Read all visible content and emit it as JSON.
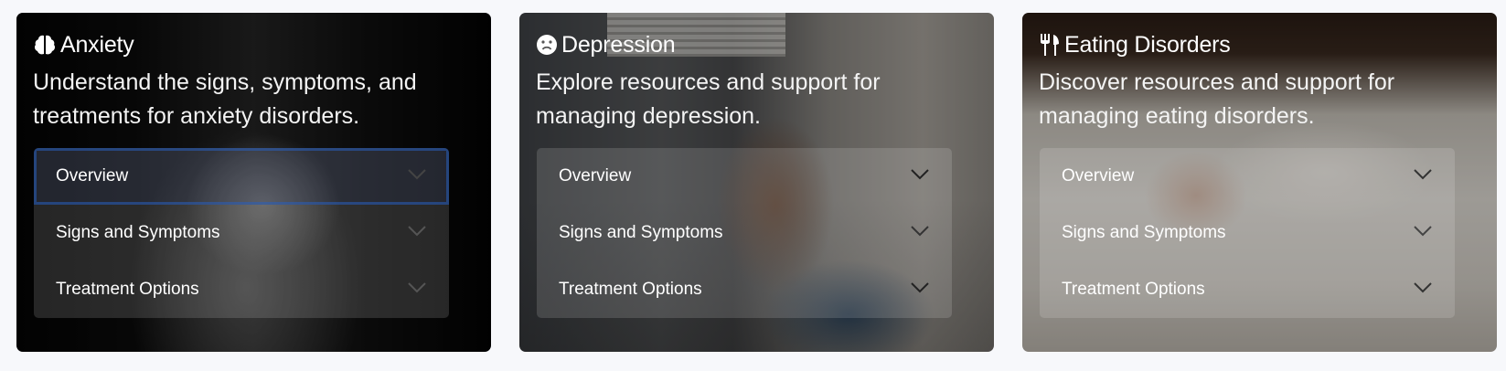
{
  "cards": [
    {
      "icon": "brain-icon",
      "title": "Anxiety",
      "description": "Understand the signs, symptoms, and treatments for anxiety disorders.",
      "accordion": [
        "Overview",
        "Signs and Symptoms",
        "Treatment Options"
      ]
    },
    {
      "icon": "sad-face-icon",
      "title": "Depression",
      "description": "Explore resources and support for managing depression.",
      "accordion": [
        "Overview",
        "Signs and Symptoms",
        "Treatment Options"
      ]
    },
    {
      "icon": "utensils-icon",
      "title": "Eating Disorders",
      "description": "Discover resources and support for managing eating disorders.",
      "accordion": [
        "Overview",
        "Signs and Symptoms",
        "Treatment Options"
      ]
    }
  ],
  "colors": {
    "page_background": "#f7f8fb",
    "text": "#ffffff",
    "focus_ring": "#285fbe"
  }
}
